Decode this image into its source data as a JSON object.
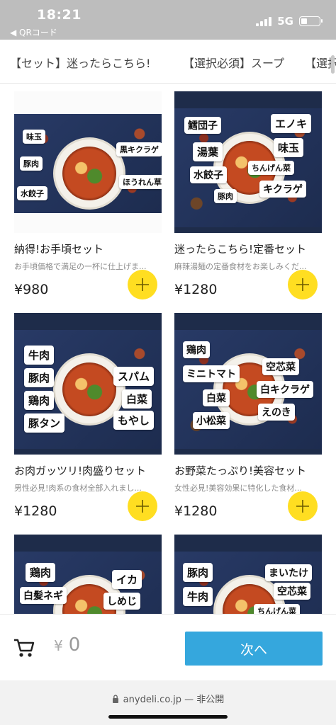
{
  "status_bar": {
    "time": "18:21",
    "back_label": "◀ QRコード",
    "network": "5G",
    "battery_level": 0.35
  },
  "tabs": [
    {
      "label": "【セット】迷ったらこちら!"
    },
    {
      "label": "【選択必須】スープ"
    },
    {
      "label": "【選択"
    }
  ],
  "products": [
    {
      "name": "納得!お手頃セット",
      "description": "お手頃価格で満足の一杯に仕上げま...",
      "price": "¥980",
      "tags": [
        "味玉",
        "豚肉",
        "水餃子",
        "黒キクラゲ",
        "ほうれん草"
      ]
    },
    {
      "name": "迷ったらこちら!定番セット",
      "description": "麻辣湯麺の定番食材をお楽しみくだ...",
      "price": "¥1280",
      "tags": [
        "鱈団子",
        "エノキ",
        "湯葉",
        "味玉",
        "水餃子",
        "ちんげん菜",
        "豚肉",
        "キクラゲ"
      ]
    },
    {
      "name": "お肉ガッツリ!肉盛りセット",
      "description": "男性必見!肉系の食材全部入れまし...",
      "price": "¥1280",
      "tags": [
        "牛肉",
        "豚肉",
        "スパム",
        "鶏肉",
        "白菜",
        "豚タン",
        "もやし"
      ]
    },
    {
      "name": "お野菜たっぷり!美容セット",
      "description": "女性必見!美容効果に特化した食材...",
      "price": "¥1280",
      "tags": [
        "鶏肉",
        "空芯菜",
        "ミニトマト",
        "白キクラゲ",
        "白菜",
        "えのき",
        "小松菜"
      ]
    },
    {
      "name": "",
      "description": "",
      "price": "",
      "tags": [
        "鶏肉",
        "イカ",
        "白髪ネギ",
        "しめじ"
      ]
    },
    {
      "name": "",
      "description": "",
      "price": "",
      "tags": [
        "豚肉",
        "まいたけ",
        "牛肉",
        "空芯菜",
        "ちんげん菜"
      ]
    }
  ],
  "cart": {
    "currency": "¥",
    "amount": "0",
    "next_label": "次へ"
  },
  "address_bar": {
    "domain": "anydeli.co.jp",
    "visibility": " — 非公開"
  },
  "colors": {
    "accent_blue": "#35a7dd",
    "add_yellow": "#ffde21",
    "status_gray": "#bdbdbd"
  },
  "icons": {
    "cart": "shopping-cart-icon",
    "add": "plus-icon",
    "lock": "lock-icon",
    "battery": "battery-icon",
    "signal": "signal-icon"
  }
}
